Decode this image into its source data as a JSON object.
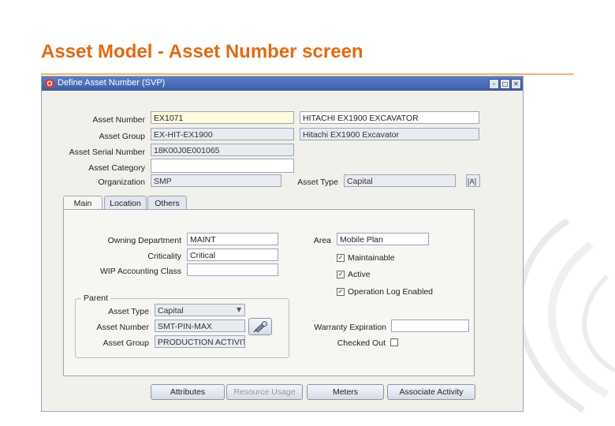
{
  "slide": {
    "title": "Asset Model - Asset Number screen"
  },
  "window": {
    "title": "Define Asset Number (SVP)",
    "icon_letter": "O",
    "controls": {
      "minimize": "–",
      "maximize": "□",
      "close": "✕"
    }
  },
  "header_fields": {
    "asset_number": {
      "label": "Asset Number",
      "value": "EX1071",
      "description": "HITACHI EX1900 EXCAVATOR"
    },
    "asset_group": {
      "label": "Asset Group",
      "value": "EX-HIT-EX1900",
      "description": "Hitachi EX1900 Excavator"
    },
    "asset_serial_number": {
      "label": "Asset Serial Number",
      "value": "18K00J0E001065"
    },
    "asset_category": {
      "label": "Asset Category",
      "value": ""
    },
    "organization": {
      "label": "Organization",
      "value": "SMP"
    },
    "asset_type": {
      "label": "Asset Type",
      "value": "Capital",
      "extra": "[A]"
    }
  },
  "tabs": [
    {
      "label": "Main",
      "active": true
    },
    {
      "label": "Location",
      "active": false
    },
    {
      "label": "Others",
      "active": false
    }
  ],
  "main_tab": {
    "owning_department": {
      "label": "Owning Department",
      "value": "MAINT"
    },
    "criticality": {
      "label": "Criticality",
      "value": "Critical"
    },
    "wip_accounting_class": {
      "label": "WIP Accounting Class",
      "value": ""
    },
    "area": {
      "label": "Area",
      "value": "Mobile Plan"
    },
    "maintainable": {
      "label": "Maintainable",
      "checked": true
    },
    "active": {
      "label": "Active",
      "checked": true
    },
    "operation_log_enabled": {
      "label": "Operation Log Enabled",
      "checked": true
    },
    "warranty_expiration": {
      "label": "Warranty Expiration",
      "value": ""
    },
    "checked_out": {
      "label": "Checked Out",
      "checked": false
    },
    "parent": {
      "legend": "Parent",
      "asset_type": {
        "label": "Asset Type",
        "value": "Capital"
      },
      "asset_number": {
        "label": "Asset Number",
        "value": "SMT-PIN-MAX"
      },
      "asset_group": {
        "label": "Asset Group",
        "value": "PRODUCTION ACTIVIT"
      }
    }
  },
  "buttons": {
    "attributes": "Attributes",
    "resource_usage": "Resource Usage",
    "meters": "Meters",
    "associate_activity": "Associate Activity"
  },
  "colors": {
    "title_orange": "#e06a12",
    "titlebar_blue": "#3b5ea8"
  },
  "icons": {
    "window": "oracle-icon",
    "lov": "flashlight-icon",
    "dropdown": "chevron-down-icon",
    "decor": "swoosh-icon"
  }
}
